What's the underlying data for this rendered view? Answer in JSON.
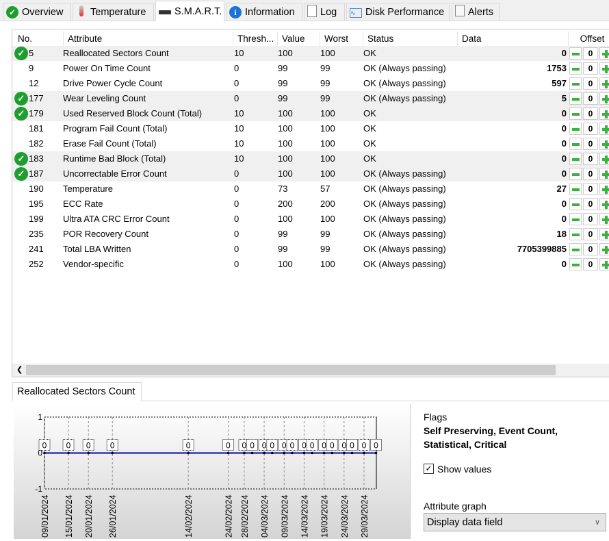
{
  "tabs": [
    {
      "label": "Overview",
      "icon": "check-circle-icon"
    },
    {
      "label": "Temperature",
      "icon": "thermometer-icon"
    },
    {
      "label": "S.M.A.R.T.",
      "icon": "drive-icon",
      "active": true
    },
    {
      "label": "Information",
      "icon": "info-icon"
    },
    {
      "label": "Log",
      "icon": "document-icon"
    },
    {
      "label": "Disk Performance",
      "icon": "chart-icon"
    },
    {
      "label": "Alerts",
      "icon": "copy-icon"
    }
  ],
  "columns": [
    "No.",
    "Attribute",
    "Thresh...",
    "Value",
    "Worst",
    "Status",
    "Data",
    "Offset"
  ],
  "rows": [
    {
      "no": "5",
      "attr": "Reallocated Sectors Count",
      "th": "10",
      "val": "100",
      "worst": "100",
      "status": "OK",
      "data": "0",
      "offset": "0",
      "ok": true
    },
    {
      "no": "9",
      "attr": "Power On Time Count",
      "th": "0",
      "val": "99",
      "worst": "99",
      "status": "OK (Always passing)",
      "data": "1753",
      "offset": "0"
    },
    {
      "no": "12",
      "attr": "Drive Power Cycle Count",
      "th": "0",
      "val": "99",
      "worst": "99",
      "status": "OK (Always passing)",
      "data": "597",
      "offset": "0"
    },
    {
      "no": "177",
      "attr": "Wear Leveling Count",
      "th": "0",
      "val": "99",
      "worst": "99",
      "status": "OK (Always passing)",
      "data": "5",
      "offset": "0",
      "ok": true
    },
    {
      "no": "179",
      "attr": "Used Reserved Block Count (Total)",
      "th": "10",
      "val": "100",
      "worst": "100",
      "status": "OK",
      "data": "0",
      "offset": "0",
      "ok": true
    },
    {
      "no": "181",
      "attr": "Program Fail Count (Total)",
      "th": "10",
      "val": "100",
      "worst": "100",
      "status": "OK",
      "data": "0",
      "offset": "0"
    },
    {
      "no": "182",
      "attr": "Erase Fail Count (Total)",
      "th": "10",
      "val": "100",
      "worst": "100",
      "status": "OK",
      "data": "0",
      "offset": "0"
    },
    {
      "no": "183",
      "attr": "Runtime Bad Block (Total)",
      "th": "10",
      "val": "100",
      "worst": "100",
      "status": "OK",
      "data": "0",
      "offset": "0",
      "ok": true
    },
    {
      "no": "187",
      "attr": "Uncorrectable Error Count",
      "th": "0",
      "val": "100",
      "worst": "100",
      "status": "OK (Always passing)",
      "data": "0",
      "offset": "0",
      "ok": true
    },
    {
      "no": "190",
      "attr": "Temperature",
      "th": "0",
      "val": "73",
      "worst": "57",
      "status": "OK (Always passing)",
      "data": "27",
      "offset": "0"
    },
    {
      "no": "195",
      "attr": "ECC Rate",
      "th": "0",
      "val": "200",
      "worst": "200",
      "status": "OK (Always passing)",
      "data": "0",
      "offset": "0"
    },
    {
      "no": "199",
      "attr": "Ultra ATA CRC Error Count",
      "th": "0",
      "val": "100",
      "worst": "100",
      "status": "OK (Always passing)",
      "data": "0",
      "offset": "0"
    },
    {
      "no": "235",
      "attr": "POR Recovery Count",
      "th": "0",
      "val": "99",
      "worst": "99",
      "status": "OK (Always passing)",
      "data": "18",
      "offset": "0"
    },
    {
      "no": "241",
      "attr": "Total LBA Written",
      "th": "0",
      "val": "99",
      "worst": "99",
      "status": "OK (Always passing)",
      "data": "7705399885",
      "offset": "0"
    },
    {
      "no": "252",
      "attr": "Vendor-specific",
      "th": "0",
      "val": "100",
      "worst": "100",
      "status": "OK (Always passing)",
      "data": "0",
      "offset": "0"
    }
  ],
  "bottom_tab": "Reallocated Sectors Count",
  "flags": {
    "label": "Flags",
    "value_line1": "Self Preserving, Event Count,",
    "value_line2": "Statistical, Critical"
  },
  "show_values": {
    "label": "Show values",
    "checked": true
  },
  "attribute_graph": {
    "label": "Attribute graph",
    "selected": "Display data field"
  },
  "chart_data": {
    "type": "line",
    "ylim": [
      -1,
      1
    ],
    "yticks": [
      "1",
      "0",
      "-1"
    ],
    "grid": true,
    "line_color": "#0000a0",
    "x_tick_labels": [
      "09/01/2024",
      "15/01/2024",
      "20/01/2024",
      "26/01/2024",
      "14/02/2024",
      "24/02/2024",
      "28/02/2024",
      "04/03/2024",
      "09/03/2024",
      "14/03/2024",
      "19/03/2024",
      "24/03/2024",
      "29/03/2024"
    ],
    "points": [
      [
        "2024-01-09",
        0
      ],
      [
        "2024-01-15",
        0
      ],
      [
        "2024-01-20",
        0
      ],
      [
        "2024-01-26",
        0
      ],
      [
        "2024-02-14",
        0
      ],
      [
        "2024-02-24",
        0
      ],
      [
        "2024-02-28",
        0
      ],
      [
        "2024-03-01",
        0
      ],
      [
        "2024-03-04",
        0
      ],
      [
        "2024-03-06",
        0
      ],
      [
        "2024-03-09",
        0
      ],
      [
        "2024-03-11",
        0
      ],
      [
        "2024-03-14",
        0
      ],
      [
        "2024-03-16",
        0
      ],
      [
        "2024-03-19",
        0
      ],
      [
        "2024-03-21",
        0
      ],
      [
        "2024-03-24",
        0
      ],
      [
        "2024-03-26",
        0
      ],
      [
        "2024-03-29",
        0
      ],
      [
        "2024-04-01",
        0
      ]
    ]
  }
}
